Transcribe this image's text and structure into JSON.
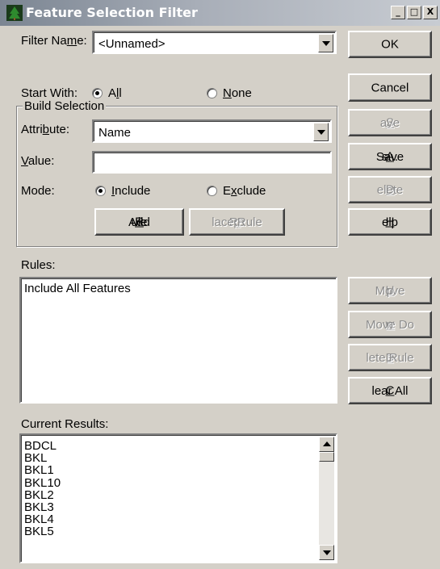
{
  "window": {
    "title": "Feature Selection Filter",
    "minimize": "_",
    "maximize": "□",
    "close": "X"
  },
  "filter_name": {
    "label_pre": "Filter Na",
    "label_key": "m",
    "label_post": "e:",
    "value": "<Unnamed>"
  },
  "start_with": {
    "label": "Start With:",
    "options": [
      {
        "pre": "A",
        "key": "l",
        "post": "l",
        "selected": true
      },
      {
        "pre": "",
        "key": "N",
        "post": "one",
        "selected": false
      }
    ]
  },
  "build_selection": {
    "title": "Build Selection",
    "attribute_label_pre": "Attri",
    "attribute_label_key": "b",
    "attribute_label_post": "ute:",
    "attribute_value": "Name",
    "value_label_key": "V",
    "value_label_post": "alue:",
    "value_input": "",
    "mode_label": "Mode:",
    "mode_options": [
      {
        "pre": "",
        "key": "I",
        "post": "nclude",
        "selected": true
      },
      {
        "pre": "E",
        "key": "x",
        "post": "clude",
        "selected": false
      }
    ],
    "add_rule_pre": "Add ",
    "add_rule_key": "R",
    "add_rule_post": "ule",
    "replace_rule_pre": "Re",
    "replace_rule_key": "p",
    "replace_rule_post": "lace Rule"
  },
  "side_buttons": {
    "ok": "OK",
    "cancel": "Cancel",
    "save_key": "S",
    "save_post": "ave",
    "save_as_pre": "Save ",
    "save_as_key": "A",
    "save_as_post": "s...",
    "delete_key": "D",
    "delete_post": "elete",
    "help_key": "H",
    "help_post": "elp"
  },
  "rules": {
    "label": "Rules:",
    "items": [
      "Include All Features"
    ]
  },
  "rule_buttons": {
    "move_up_pre": "Move ",
    "move_up_key": "U",
    "move_up_post": "p",
    "move_down_pre": "Move Do",
    "move_down_key": "w",
    "move_down_post": "n",
    "delete_rule_pre": "D",
    "delete_rule_key": "e",
    "delete_rule_post": "lete Rule",
    "clear_all_key": "C",
    "clear_all_post": "lear All"
  },
  "current_results": {
    "label": "Current Results:",
    "items": [
      "BDCL",
      "BKL",
      "BKL1",
      "BKL10",
      "BKL2",
      "BKL3",
      "BKL4",
      "BKL5"
    ]
  }
}
